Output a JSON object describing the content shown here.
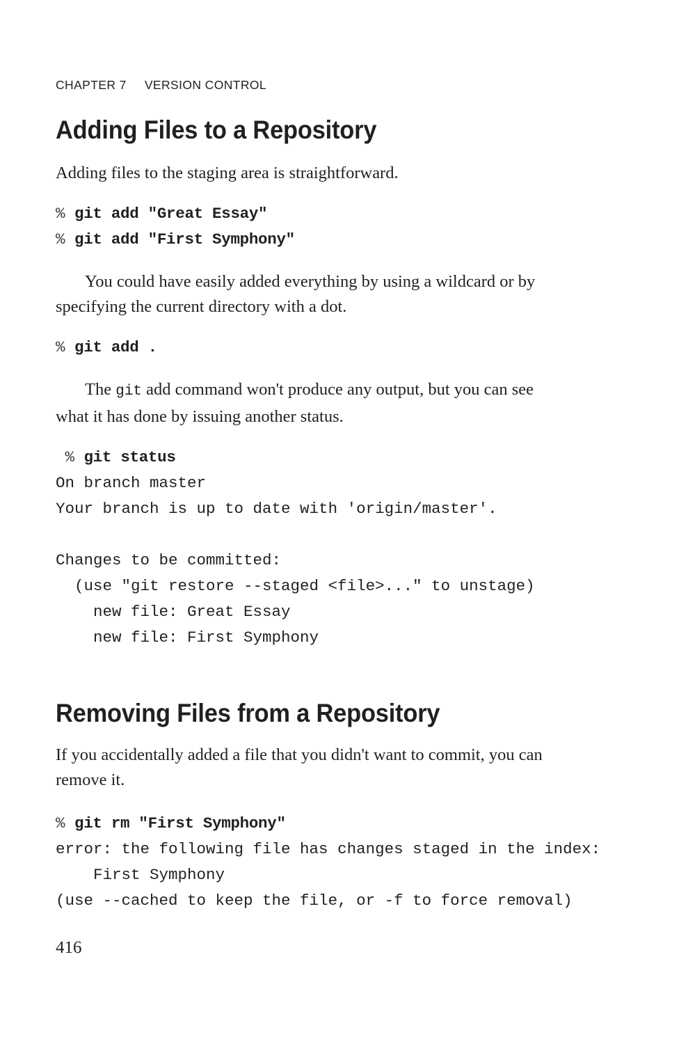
{
  "page": {
    "folio": "416",
    "running_head": {
      "chapter": "CHAPTER 7",
      "title": "VERSION CONTROL"
    }
  },
  "sections": [
    {
      "heading": "Adding Files to a Repository",
      "intro": "Adding files to the staging area is straightforward.",
      "code_block_1": {
        "lines": [
          {
            "prompt": "% ",
            "command": "git add \"Great Essay\""
          },
          {
            "prompt": "% ",
            "command": "git add \"First Symphony\""
          }
        ]
      },
      "para_1": "You could have easily added everything by using a wildcard or by specifying the current directory with a dot.",
      "code_block_2": {
        "lines": [
          {
            "prompt": "% ",
            "command": "git add ."
          }
        ]
      },
      "para_2_part1": "The ",
      "para_2_code": "git",
      "para_2_part2": " add command won't produce any output, but you can see what it has done by issuing another status.",
      "code_block_3": {
        "prompt": " % ",
        "command": "git status",
        "output": [
          "On branch master",
          "Your branch is up to date with 'origin/master'.",
          "",
          "Changes to be committed:",
          "  (use \"git restore --staged <file>...\" to unstage)",
          "    new file: Great Essay",
          "    new file: First Symphony"
        ]
      }
    },
    {
      "heading": "Removing Files from a Repository",
      "intro": "If you accidentally added a file that you didn't want to commit, you can remove it.",
      "code_block_1": {
        "prompt": "% ",
        "command": "git rm \"First Symphony\"",
        "output": [
          "error: the following file has changes staged in the index:",
          "    First Symphony",
          "(use --cached to keep the file, or -f to force removal)"
        ]
      }
    }
  ]
}
